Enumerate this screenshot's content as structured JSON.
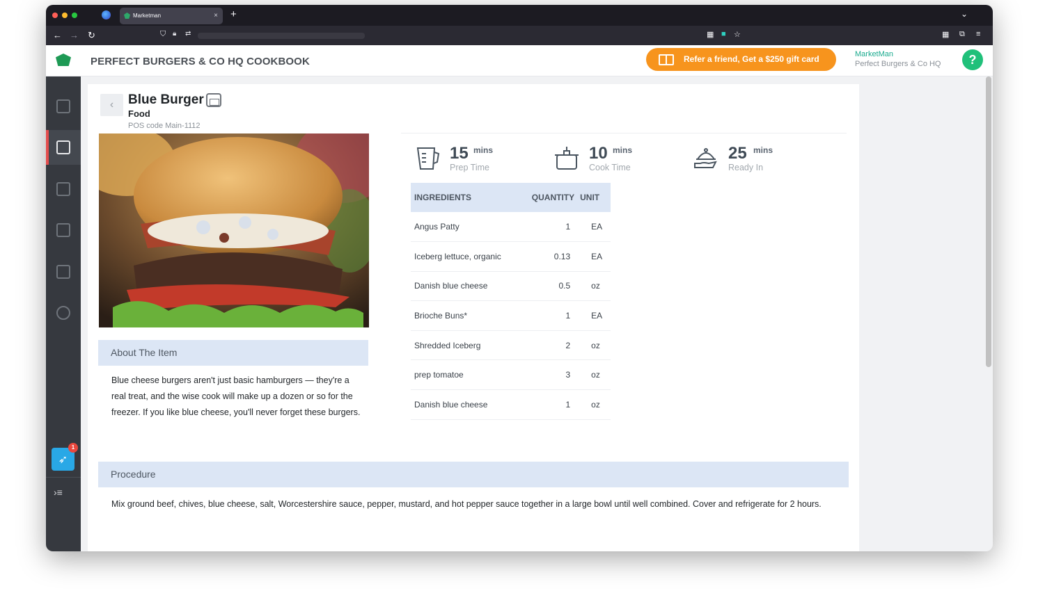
{
  "browser": {
    "tab_title": "Marketman",
    "new_tab": "+",
    "close": "×"
  },
  "header": {
    "title": "PERFECT BURGERS & CO HQ COOKBOOK",
    "refer_label": "Refer a friend, Get a $250 gift card",
    "user_name": "MarketMan",
    "user_org": "Perfect Burgers & Co HQ",
    "help_label": "?"
  },
  "sidebar": {
    "items": [
      "orders",
      "recipes",
      "delivery",
      "inventory",
      "reports",
      "settings"
    ],
    "active": "recipes",
    "notification_count": "1",
    "expand_glyph": "›≡"
  },
  "item": {
    "back_glyph": "‹",
    "name": "Blue Burger",
    "category": "Food",
    "pos_code": "POS code Main-1112",
    "about_title": "About The Item",
    "about_text": "Blue cheese burgers aren't just basic hamburgers — they're a real treat, and the wise cook will make up a dozen or so for the freezer. If you like blue cheese, you'll never forget these burgers.",
    "procedure_title": "Procedure",
    "procedure_text": "Mix ground beef, chives, blue cheese, salt, Worcestershire sauce, pepper, mustard, and hot pepper sauce together in a large bowl until well combined. Cover and refrigerate for 2 hours."
  },
  "times": [
    {
      "value": "15",
      "unit": "mins",
      "label": "Prep Time",
      "icon": "measuring-cup-icon"
    },
    {
      "value": "10",
      "unit": "mins",
      "label": "Cook Time",
      "icon": "pot-icon"
    },
    {
      "value": "25",
      "unit": "mins",
      "label": "Ready In",
      "icon": "serving-cloche-icon"
    }
  ],
  "ingredients": {
    "headers": {
      "name": "INGREDIENTS",
      "quantity": "QUANTITY",
      "unit": "UNIT"
    },
    "rows": [
      {
        "name": "Angus Patty",
        "quantity": "1",
        "unit": "EA"
      },
      {
        "name": "Iceberg lettuce, organic",
        "quantity": "0.13",
        "unit": "EA"
      },
      {
        "name": "Danish blue cheese",
        "quantity": "0.5",
        "unit": "oz"
      },
      {
        "name": "Brioche Buns*",
        "quantity": "1",
        "unit": "EA"
      },
      {
        "name": "Shredded Iceberg",
        "quantity": "2",
        "unit": "oz"
      },
      {
        "name": "prep tomatoe",
        "quantity": "3",
        "unit": "oz"
      },
      {
        "name": "Danish blue cheese",
        "quantity": "1",
        "unit": "oz"
      }
    ]
  },
  "colors": {
    "accent_green": "#1e9a55",
    "refer_orange": "#f7941d",
    "active_marker": "#e44d4d",
    "section_header_bg": "#dce6f5",
    "sidebar_bg": "#36393f"
  }
}
